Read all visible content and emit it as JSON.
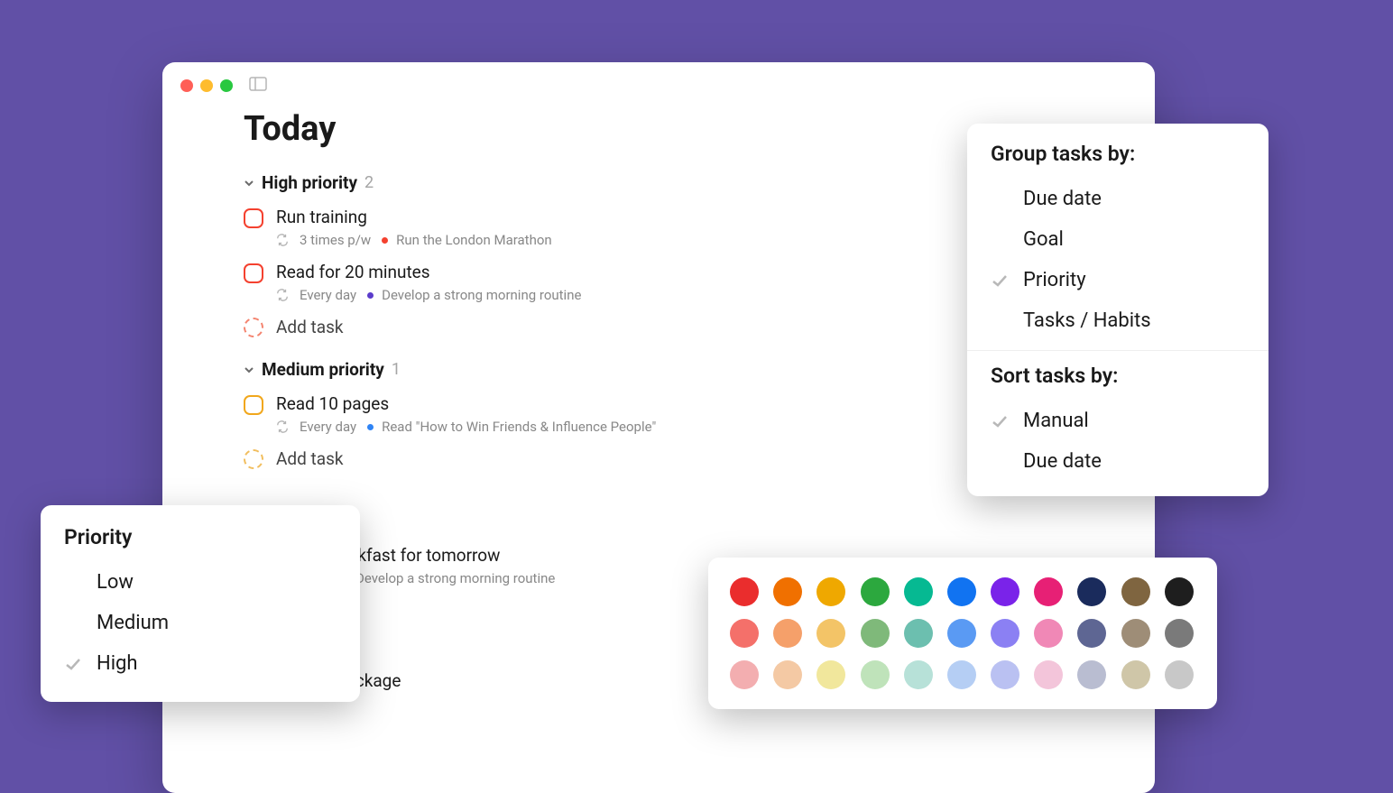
{
  "page_title": "Today",
  "sections": [
    {
      "name": "High priority",
      "count": "2",
      "tasks": [
        {
          "title": "Run training",
          "recur": "3 times p/w",
          "tag": "Run the London Marathon",
          "dot": "#f4412f"
        },
        {
          "title": "Read for 20 minutes",
          "recur": "Every day",
          "tag": "Develop a strong morning routine",
          "dot": "#5b3ccb"
        }
      ],
      "add_label": "Add task"
    },
    {
      "name": "Medium priority",
      "count": "1",
      "tasks": [
        {
          "title": "Read 10 pages",
          "recur": "Every day",
          "tag": "Read \"How to Win Friends & Influence People\"",
          "dot": "#2f84f5"
        }
      ],
      "add_label": "Add task"
    }
  ],
  "partial_task": {
    "title_frag": "akfast for tomorrow",
    "tag": "Develop a strong morning routine",
    "dot": "#5b3ccb"
  },
  "last_visible_task": "Pick up package",
  "priority_popover": {
    "title": "Priority",
    "items": [
      "Low",
      "Medium",
      "High"
    ],
    "selected": "High"
  },
  "group_popover": {
    "group_title": "Group tasks by:",
    "group_items": [
      "Due date",
      "Goal",
      "Priority",
      "Tasks / Habits"
    ],
    "group_selected": "Priority",
    "sort_title": "Sort tasks by:",
    "sort_items": [
      "Manual",
      "Due date"
    ],
    "sort_selected": "Manual"
  },
  "colors": [
    "#ea2d2d",
    "#f07000",
    "#efa800",
    "#2ca83e",
    "#06b992",
    "#1173f1",
    "#7a23e9",
    "#e72075",
    "#1a2b5c",
    "#7f6540",
    "#1e1e1e",
    "#f4706a",
    "#f5a06a",
    "#f3c467",
    "#7fb97a",
    "#6cbfaf",
    "#5a9af3",
    "#8b80f3",
    "#f088b6",
    "#5e6693",
    "#9e8d77",
    "#7a7a7a",
    "#f3aeb0",
    "#f4c9a4",
    "#f1e79c",
    "#bfe3ba",
    "#b7e1d8",
    "#b5cef4",
    "#bac1f2",
    "#f3c5da",
    "#b9bdd1",
    "#cfc6a8",
    "#c8c8c8"
  ]
}
